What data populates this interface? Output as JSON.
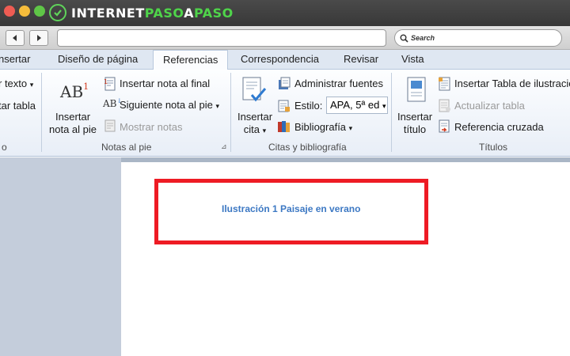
{
  "browser": {
    "logo": {
      "part1": "INTERNET",
      "part2": "PASO",
      "part3": "A",
      "part4": "PASO"
    },
    "search_placeholder": "Search"
  },
  "colors": {
    "accent_green": "#4fd44a",
    "highlight_red": "#ee1b24",
    "caption_blue": "#3c78c3"
  },
  "ribbon_tabs": [
    "nsertar",
    "Diseño de página",
    "Referencias",
    "Correspondencia",
    "Revisar",
    "Vista"
  ],
  "active_tab": "Referencias",
  "toc_group": {
    "item1": "r texto",
    "item2": "tar tabla",
    "label": "o"
  },
  "footnotes_group": {
    "big_button": "Insertar nota al pie",
    "big_button_line1": "Insertar",
    "big_button_line2": "nota al pie",
    "icon_text": "AB",
    "icon_sup": "1",
    "insert_endnote": "Insertar nota al final",
    "next_footnote": "Siguiente nota al pie",
    "show_notes": "Mostrar notas",
    "label": "Notas al pie"
  },
  "citations_group": {
    "insert_citation_line1": "Insertar",
    "insert_citation_line2": "cita",
    "manage_sources": "Administrar fuentes",
    "style_label": "Estilo:",
    "style_value": "APA, 5ª ed",
    "bibliography": "Bibliografía",
    "label": "Citas y bibliografía"
  },
  "captions_group": {
    "insert_caption_line1": "Insertar",
    "insert_caption_line2": "título",
    "insert_table_of_figures": "Insertar Tabla de ilustracio",
    "update_table": "Actualizar tabla",
    "cross_reference": "Referencia cruzada",
    "label": "Títulos"
  },
  "document": {
    "caption": "Ilustración 1 Paisaje en verano"
  }
}
